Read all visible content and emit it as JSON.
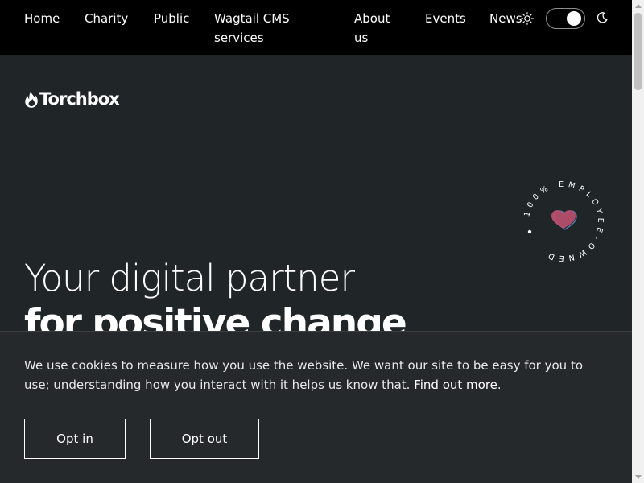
{
  "nav": {
    "items": [
      "Home",
      "Charity",
      "Public",
      "Wagtail CMS\nservices",
      "About\nus",
      "Events",
      "News"
    ]
  },
  "theme_toggle": {
    "state": "dark"
  },
  "logo": {
    "text": "Torchbox"
  },
  "badge": {
    "text": "100% EMPLOYEE-OWNED",
    "icon": "heart-icon"
  },
  "hero": {
    "line1": "Your digital partner",
    "line2": "for positive change"
  },
  "cookie_banner": {
    "text": "We use cookies to measure how you use the website. We want our site to be easy for you to use; understanding how you interact with it helps us know that.",
    "link": "Find out more",
    "trailing": ".",
    "opt_in": "Opt in",
    "opt_out": "Opt out"
  },
  "colors": {
    "background": "#202528",
    "nav_background": "#000000",
    "banner_background": "#25292c",
    "heart": "#c25a78"
  }
}
